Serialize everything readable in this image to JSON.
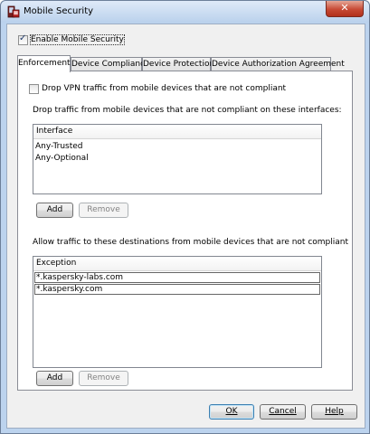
{
  "window": {
    "title": "Mobile Security",
    "close_glyph": "✕",
    "app_icon": "mobile-security-app-icon"
  },
  "enable": {
    "label": "Enable Mobile Security",
    "checked": true
  },
  "tabs": [
    {
      "label": "Enforcement",
      "active": true
    },
    {
      "label": "Device Compliance",
      "active": false
    },
    {
      "label": "Device Protection",
      "active": false
    },
    {
      "label": "Device Authorization Agreement",
      "active": false
    }
  ],
  "enforcement": {
    "drop_vpn_label": "Drop VPN traffic from mobile devices that are not compliant",
    "drop_vpn_checked": false,
    "drop_interfaces_label": "Drop traffic from mobile devices that are not compliant on these interfaces:",
    "interfaces": {
      "header": "Interface",
      "rows": [
        "Any-Trusted",
        "Any-Optional"
      ]
    },
    "interfaces_add": "Add",
    "interfaces_remove": "Remove",
    "allow_label": "Allow traffic to these destinations from mobile devices that are not compliant",
    "exceptions": {
      "header": "Exception",
      "rows": [
        "*.kaspersky-labs.com",
        "*.kaspersky.com"
      ]
    },
    "exceptions_add": "Add",
    "exceptions_remove": "Remove"
  },
  "footer": {
    "ok": "OK",
    "cancel": "Cancel",
    "help": "Help"
  }
}
